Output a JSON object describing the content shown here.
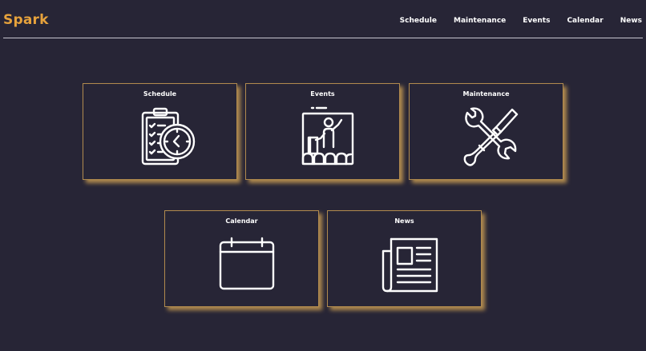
{
  "brand": {
    "name": "Spark"
  },
  "nav": {
    "items": [
      "Schedule",
      "Maintenance",
      "Events",
      "Calendar",
      "News"
    ]
  },
  "cards": [
    {
      "title": "Schedule",
      "icon": "clipboard-clock-icon"
    },
    {
      "title": "Events",
      "icon": "stage-presenter-icon"
    },
    {
      "title": "Maintenance",
      "icon": "wrench-screwdriver-icon"
    },
    {
      "title": "Calendar",
      "icon": "calendar-icon"
    },
    {
      "title": "News",
      "icon": "newspaper-icon"
    }
  ],
  "colors": {
    "background": "#272536",
    "accent": "#e6a23c",
    "card_border": "#b08a4e",
    "text": "#ffffff"
  }
}
